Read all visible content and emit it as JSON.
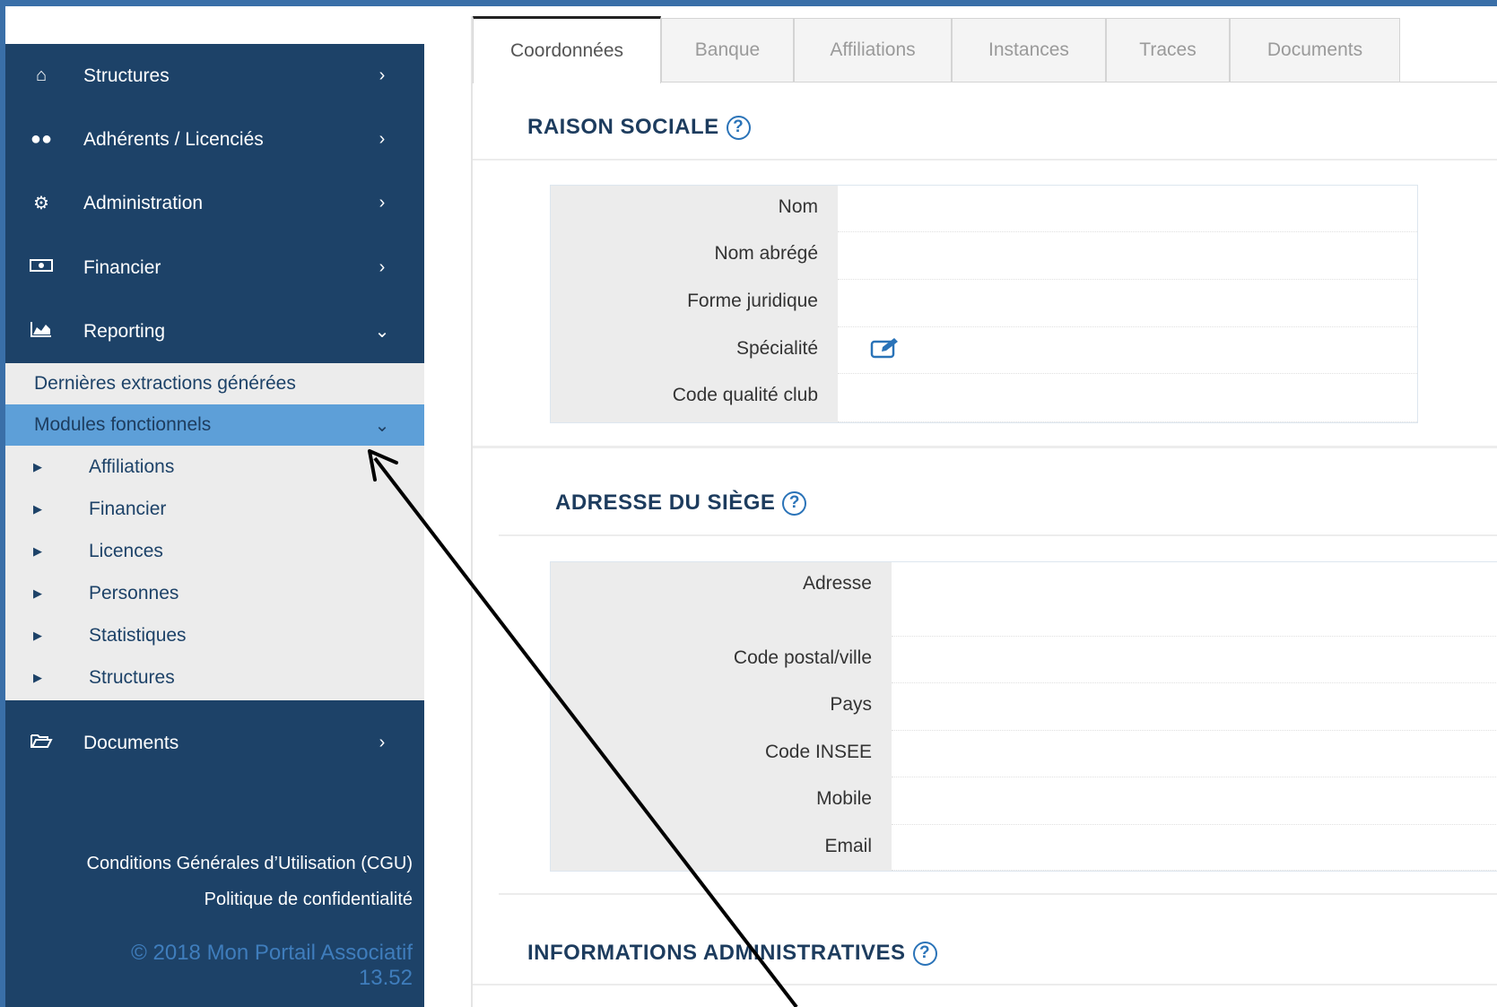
{
  "sidebar": {
    "menu": [
      {
        "label": "Structures",
        "icon": "home-icon"
      },
      {
        "label": "Adhérents / Licenciés",
        "icon": "users-icon"
      },
      {
        "label": "Administration",
        "icon": "gears-icon"
      },
      {
        "label": "Financier",
        "icon": "money-icon"
      },
      {
        "label": "Reporting",
        "icon": "area-chart-icon"
      },
      {
        "label": "Documents",
        "icon": "folder-open-icon"
      }
    ],
    "reporting_links": [
      {
        "label": "Dernières extractions générées"
      },
      {
        "label": "Modules fonctionnels"
      }
    ],
    "modules": [
      {
        "label": "Affiliations"
      },
      {
        "label": "Financier"
      },
      {
        "label": "Licences"
      },
      {
        "label": "Personnes"
      },
      {
        "label": "Statistiques"
      },
      {
        "label": "Structures"
      }
    ],
    "footer": {
      "cgu": "Conditions Générales d’Utilisation (CGU)",
      "privacy": "Politique de confidentialité",
      "copyright": "© 2018 Mon Portail Associatif",
      "version": "13.52"
    }
  },
  "tabs": [
    {
      "label": "Coordonnées",
      "active": true
    },
    {
      "label": "Banque"
    },
    {
      "label": "Affiliations"
    },
    {
      "label": "Instances"
    },
    {
      "label": "Traces"
    },
    {
      "label": "Documents"
    }
  ],
  "sections": {
    "raison_sociale": {
      "title": "RAISON SOCIALE",
      "fields": [
        "Nom",
        "Nom abrégé",
        "Forme juridique",
        "Spécialité",
        "Code qualité club"
      ]
    },
    "adresse": {
      "title": "ADRESSE DU SIÈGE",
      "fields": [
        "Adresse",
        "Code postal/ville",
        "Pays",
        "Code INSEE",
        "Mobile",
        "Email"
      ]
    },
    "infos_admin": {
      "title": "INFORMATIONS ADMINISTRATIVES"
    }
  },
  "colors": {
    "sidebar_bg": "#1d4268",
    "submenu_bg": "#ececec",
    "active_submenu": "#5d9fd8",
    "accent": "#2a73b8"
  }
}
